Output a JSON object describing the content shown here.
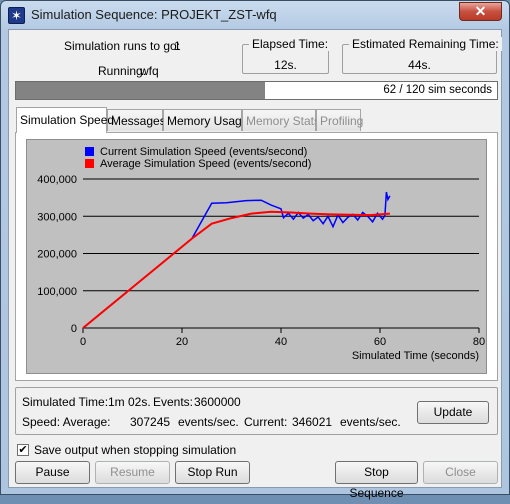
{
  "window": {
    "title": "Simulation Sequence: PROJEKT_ZST-wfq",
    "close_glyph": "✕",
    "icon_glyph": "✶"
  },
  "status": {
    "runs_label": "Simulation runs to go:",
    "runs_value": "1",
    "running_label": "Running:",
    "running_value": "wfq"
  },
  "elapsed": {
    "title": "Elapsed Time:",
    "value": "12s."
  },
  "remaining": {
    "title": "Estimated Remaining Time:",
    "value": "44s."
  },
  "progress": {
    "fraction": 0.517,
    "text": "62 / 120 sim seconds"
  },
  "tabs": [
    {
      "label": "Simulation Speed",
      "active": true,
      "disabled": false
    },
    {
      "label": "Messages",
      "active": false,
      "disabled": false
    },
    {
      "label": "Memory Usage",
      "active": false,
      "disabled": false
    },
    {
      "label": "Memory Stats",
      "active": false,
      "disabled": true
    },
    {
      "label": "Profiling",
      "active": false,
      "disabled": true
    }
  ],
  "chart_data": {
    "type": "line",
    "xlabel": "Simulated Time (seconds)",
    "ylabel": "",
    "xlim": [
      0,
      80
    ],
    "ylim": [
      0,
      400000
    ],
    "x_ticks": [
      0,
      20,
      40,
      60,
      80
    ],
    "y_ticks": [
      0,
      100000,
      200000,
      300000,
      400000
    ],
    "y_tick_labels": [
      "0",
      "100,000",
      "200,000",
      "300,000",
      "400,000"
    ],
    "reference_line_y": 300000,
    "grid": "horizontal",
    "legend_position": "top-left",
    "series": [
      {
        "name": "Current Simulation Speed (events/second)",
        "color": "#0000ff",
        "x": [
          0,
          22,
          26,
          29,
          33,
          36,
          38,
          40,
          40.5,
          41.5,
          42.5,
          43.5,
          44.5,
          45.5,
          46.5,
          47.5,
          48.5,
          49.5,
          50.5,
          51.5,
          52.5,
          53.5,
          54.5,
          55.5,
          56.5,
          57.5,
          58.5,
          59.5,
          60.5,
          61,
          61.3,
          61.6,
          62
        ],
        "y": [
          0,
          240000,
          335000,
          336000,
          342000,
          343000,
          330000,
          320000,
          296000,
          308000,
          292000,
          310000,
          295000,
          305000,
          288000,
          298000,
          280000,
          300000,
          272000,
          303000,
          283000,
          297000,
          305000,
          290000,
          310000,
          300000,
          285000,
          308000,
          292000,
          302000,
          365000,
          345000,
          355000
        ]
      },
      {
        "name": "Average Simulation Speed (events/second)",
        "color": "#ff0000",
        "x": [
          0,
          22,
          26,
          30,
          34,
          38,
          42,
          46,
          50,
          54,
          58,
          62
        ],
        "y": [
          0,
          240000,
          280000,
          295000,
          307000,
          312000,
          310000,
          307000,
          305000,
          304000,
          303000,
          307000
        ]
      }
    ]
  },
  "info": {
    "simulated_time_label": "Simulated Time:",
    "simulated_time_value": "1m 02s.",
    "events_label": "Events:",
    "events_value": "3600000",
    "speed_label": "Speed: Average:",
    "speed_avg_value": "307245",
    "speed_avg_unit": "events/sec.",
    "current_label": "Current:",
    "current_value": "346021",
    "current_unit": "events/sec."
  },
  "buttons": {
    "update": "Update",
    "pause": "Pause",
    "resume": "Resume",
    "stop_run": "Stop Run",
    "stop_sequence": "Stop Sequence",
    "close": "Close"
  },
  "save_output": {
    "label": "Save output when stopping simulation",
    "checked": true,
    "check_glyph": "✔"
  }
}
